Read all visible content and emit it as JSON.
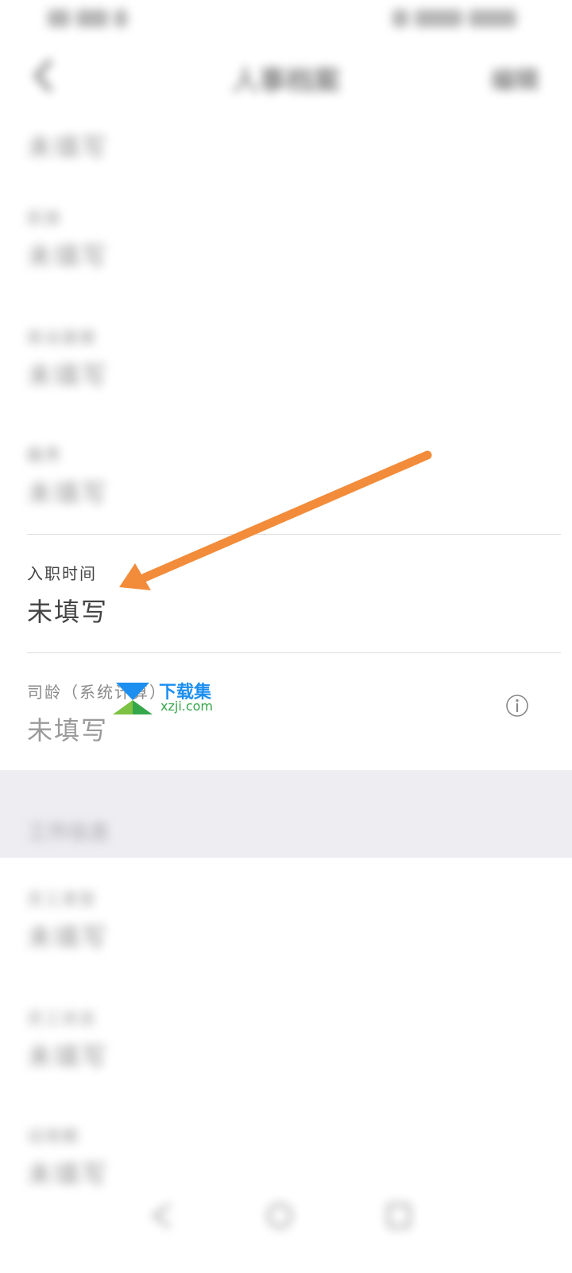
{
  "header": {
    "title": "人事档案",
    "edit_label": "编辑"
  },
  "fields": {
    "top_value": "未填写",
    "f1": {
      "label": "民族",
      "value": "未填写"
    },
    "f2": {
      "label": "政治面貌",
      "value": "未填写"
    },
    "f3": {
      "label": "籍贯",
      "value": "未填写"
    },
    "hire_date": {
      "label": "入职时间",
      "value": "未填写"
    },
    "seniority": {
      "label": "司龄（系统计算）",
      "value": "未填写"
    }
  },
  "section": {
    "title": "工作信息"
  },
  "work_fields": [
    {
      "label": "员工类型",
      "value": "未填写"
    },
    {
      "label": "员工状态",
      "value": "未填写"
    },
    {
      "label": "试用期",
      "value": "未填写"
    }
  ],
  "watermark": {
    "brand": "下载集",
    "url": "xzji.com"
  },
  "colors": {
    "arrow": "#f28c3a",
    "divider": "#dcdcdc",
    "section_bg": "#eeeef2",
    "watermark_blue": "#1c8ff0",
    "watermark_green": "#36a64b"
  },
  "icons": {
    "back": "chevron-left-icon",
    "info": "info-circle-icon"
  }
}
